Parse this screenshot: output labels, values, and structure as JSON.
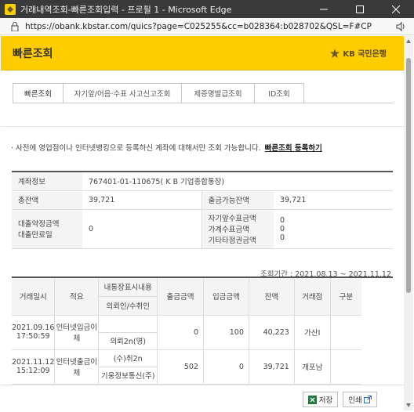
{
  "window": {
    "title": "거래내역조회-빠른조회입력 - 프로필 1 - Microsoft Edge",
    "url": "https://obank.kbstar.com/quics?page=C025255&cc=b028364:b028702&QSL=F#CP"
  },
  "header": {
    "title": "빠른조회",
    "brand": "KB 국민은행"
  },
  "tabs": [
    {
      "label": "빠른조회"
    },
    {
      "label": "자기앞/어음·수표 사고신고조회"
    },
    {
      "label": "제증명발급조회"
    },
    {
      "label": "ID조회"
    }
  ],
  "notice": {
    "text": "· 사전에 영업점이나 인터넷뱅킹으로 등록하신 계좌에 대해서만 조회 가능합니다.",
    "link": "빠른조회 등록하기"
  },
  "account": {
    "account_label": "계좌정보",
    "account_value": "767401-01-110675( K B 기업종합통장)",
    "balance_label": "총잔액",
    "balance_value": "39,721",
    "withdrawable_label": "출금가능잔액",
    "withdrawable_value": "39,721",
    "loan_label1": "대출약정금액",
    "loan_label2": "대출만료일",
    "loan_value": "0",
    "check_label1": "자기앞수표금액",
    "check_label2": "가계수표금액",
    "check_label3": "기타타점권금액",
    "check_value1": "0",
    "check_value2": "0",
    "check_value3": "0"
  },
  "period": "조회기간 : 2021.08.13 ~ 2021.11.12",
  "transactions": {
    "headers": {
      "date": "거래일시",
      "summary": "적요",
      "memo": "내통장표시내용",
      "counterpart": "의뢰인/수취인",
      "withdraw": "출금금액",
      "deposit": "입금금액",
      "balance": "잔액",
      "branch": "거래점",
      "type": "구분"
    },
    "rows": [
      {
        "date": "2021.09.16",
        "time": "17:50:59",
        "summary": "인터넷입금이체",
        "memo": "",
        "counterpart": "의뢰2n(명)",
        "withdraw": "0",
        "deposit": "100",
        "balance": "40,223",
        "branch": "가산Ⅰ",
        "type": ""
      },
      {
        "date": "2021.11.12",
        "time": "15:12:09",
        "summary": "인터넷출금이체",
        "memo": "(수)취2n",
        "counterpart": "기웅정보통신(주)",
        "withdraw": "502",
        "deposit": "0",
        "balance": "39,721",
        "branch": "개포남",
        "type": ""
      }
    ]
  },
  "buttons": {
    "save": "저장",
    "print": "인쇄"
  },
  "colors": {
    "brand_yellow": "#ffcc00",
    "titlebar": "#3a3a3a"
  }
}
